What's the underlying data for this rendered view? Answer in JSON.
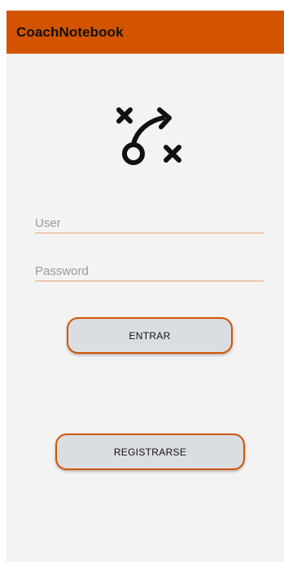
{
  "app": {
    "title": "CoachNotebook",
    "accent_color": "#d35400",
    "background_color": "#f3f3f3"
  },
  "logo": {
    "icon": "tactics-play-icon"
  },
  "login": {
    "user_placeholder": "User",
    "user_value": "",
    "password_placeholder": "Password",
    "password_value": "",
    "enter_label": "ENTRAR",
    "register_label": "REGISTRARSE"
  }
}
